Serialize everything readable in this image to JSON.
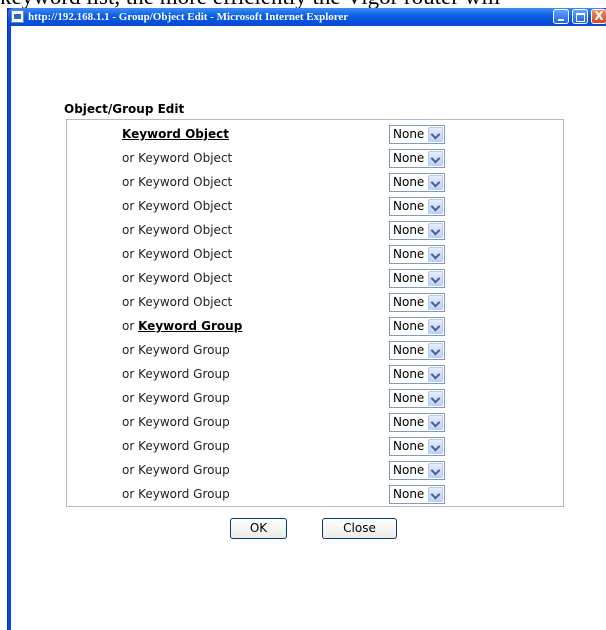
{
  "background_text": "keyword list, the more efficiently the Vigor router will",
  "window": {
    "title": "http://192.168.1.1 - Group/Object Edit - Microsoft Internet Explorer",
    "controls": {
      "minimize": "_",
      "maximize": "□",
      "close": "X"
    }
  },
  "page": {
    "heading": "Object/Group Edit",
    "rows": [
      {
        "prefix": "",
        "label": "Keyword Object",
        "emphasis": true,
        "value": "None"
      },
      {
        "prefix": "or ",
        "label": "Keyword Object",
        "emphasis": false,
        "value": "None"
      },
      {
        "prefix": "or ",
        "label": "Keyword Object",
        "emphasis": false,
        "value": "None"
      },
      {
        "prefix": "or ",
        "label": "Keyword Object",
        "emphasis": false,
        "value": "None"
      },
      {
        "prefix": "or ",
        "label": "Keyword Object",
        "emphasis": false,
        "value": "None"
      },
      {
        "prefix": "or ",
        "label": "Keyword Object",
        "emphasis": false,
        "value": "None"
      },
      {
        "prefix": "or ",
        "label": "Keyword Object",
        "emphasis": false,
        "value": "None"
      },
      {
        "prefix": "or ",
        "label": "Keyword Object",
        "emphasis": false,
        "value": "None"
      },
      {
        "prefix": "or ",
        "label": "Keyword Group",
        "emphasis": true,
        "value": "None"
      },
      {
        "prefix": "or ",
        "label": "Keyword Group",
        "emphasis": false,
        "value": "None"
      },
      {
        "prefix": "or ",
        "label": "Keyword Group",
        "emphasis": false,
        "value": "None"
      },
      {
        "prefix": "or ",
        "label": "Keyword Group",
        "emphasis": false,
        "value": "None"
      },
      {
        "prefix": "or ",
        "label": "Keyword Group",
        "emphasis": false,
        "value": "None"
      },
      {
        "prefix": "or ",
        "label": "Keyword Group",
        "emphasis": false,
        "value": "None"
      },
      {
        "prefix": "or ",
        "label": "Keyword Group",
        "emphasis": false,
        "value": "None"
      },
      {
        "prefix": "or ",
        "label": "Keyword Group",
        "emphasis": false,
        "value": "None"
      }
    ],
    "buttons": {
      "ok": "OK",
      "close": "Close"
    }
  }
}
